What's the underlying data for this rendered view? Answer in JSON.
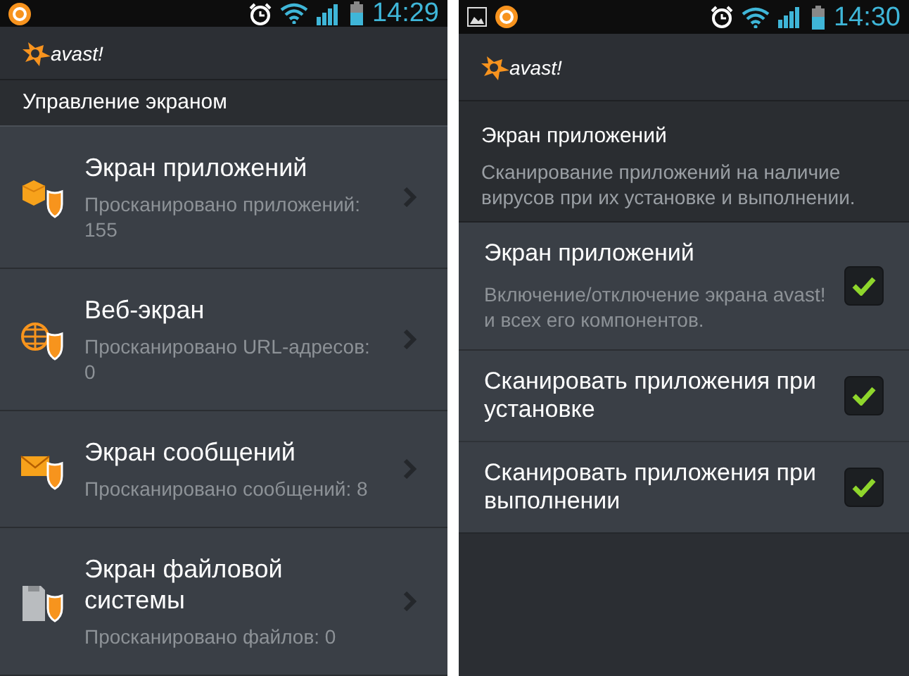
{
  "left_screen": {
    "status_bar": {
      "time": "14:29"
    },
    "app_header": {
      "logo_text": "avast!"
    },
    "section_title": "Управление экраном",
    "items": [
      {
        "kind": "apps",
        "title": "Экран приложений",
        "subtitle": "Просканировано приложений: 155"
      },
      {
        "kind": "web",
        "title": "Веб-экран",
        "subtitle": "Просканировано URL-адресов: 0"
      },
      {
        "kind": "messages",
        "title": "Экран сообщений",
        "subtitle": "Просканировано сообщений: 8"
      },
      {
        "kind": "files",
        "title": "Экран файловой системы",
        "subtitle": "Просканировано файлов: 0"
      }
    ]
  },
  "right_screen": {
    "status_bar": {
      "time": "14:30"
    },
    "app_header": {
      "logo_text": "avast!"
    },
    "section": {
      "title": "Экран приложений",
      "description": "Сканирование приложений на наличие вирусов при их установке и выполнении."
    },
    "settings": [
      {
        "title": "Экран приложений",
        "description": "Включение/отключение экрана avast! и всех его компонентов.",
        "checked": true
      },
      {
        "title": "Сканировать приложения при установке",
        "checked": true
      },
      {
        "title": "Сканировать приложения при выполнении",
        "checked": true
      }
    ]
  }
}
